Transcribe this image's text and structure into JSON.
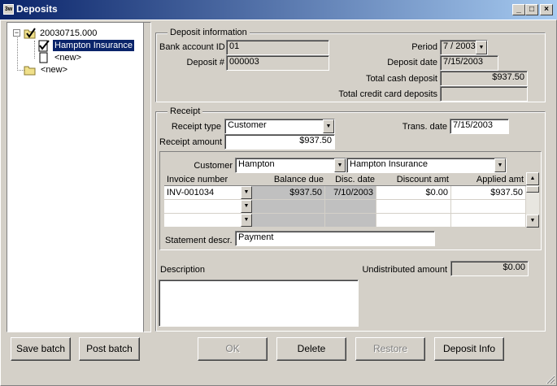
{
  "window": {
    "title": "Deposits",
    "icon_text": "3w",
    "min_glyph": "_",
    "max_glyph": "□",
    "close_glyph": "×"
  },
  "tree": {
    "expand_glyph": "−",
    "root": "20030715.000",
    "child_selected": "Hampton Insurance",
    "child_new": "<new>",
    "root_new": "<new>"
  },
  "left_buttons": {
    "save_batch": "Save batch",
    "post_batch": "Post batch"
  },
  "deposit_info": {
    "title": "Deposit information",
    "bank_account_label": "Bank account ID",
    "bank_account_value": "01",
    "deposit_num_label": "Deposit #",
    "deposit_num_value": "000003",
    "period_label": "Period",
    "period_value": "7 / 2003",
    "deposit_date_label": "Deposit date",
    "deposit_date_value": "7/15/2003",
    "total_cash_label": "Total cash deposit",
    "total_cash_value": "$937.50",
    "total_cc_label": "Total credit card deposits",
    "total_cc_value": ""
  },
  "receipt": {
    "title": "Receipt",
    "receipt_type_label": "Receipt type",
    "receipt_type_value": "Customer",
    "trans_date_label": "Trans. date",
    "trans_date_value": "7/15/2003",
    "receipt_amount_label": "Receipt amount",
    "receipt_amount_value": "$937.50",
    "customer_label": "Customer",
    "customer_id": "Hampton",
    "customer_name": "Hampton Insurance",
    "grid": {
      "headers": [
        "Invoice number",
        "Balance due",
        "Disc. date",
        "Discount amt",
        "Applied amt"
      ],
      "rows": [
        [
          "INV-001034",
          "$937.50",
          "7/10/2003",
          "$0.00",
          "$937.50"
        ],
        [
          "",
          "",
          "",
          "",
          ""
        ],
        [
          "",
          "",
          "",
          "",
          ""
        ]
      ]
    },
    "statement_descr_label": "Statement descr.",
    "statement_descr_value": "Payment",
    "description_label": "Description",
    "description_value": "",
    "undistributed_label": "Undistributed amount",
    "undistributed_value": "$0.00"
  },
  "bottom_buttons": {
    "ok": "OK",
    "delete": "Delete",
    "restore": "Restore",
    "deposit_info": "Deposit Info"
  }
}
